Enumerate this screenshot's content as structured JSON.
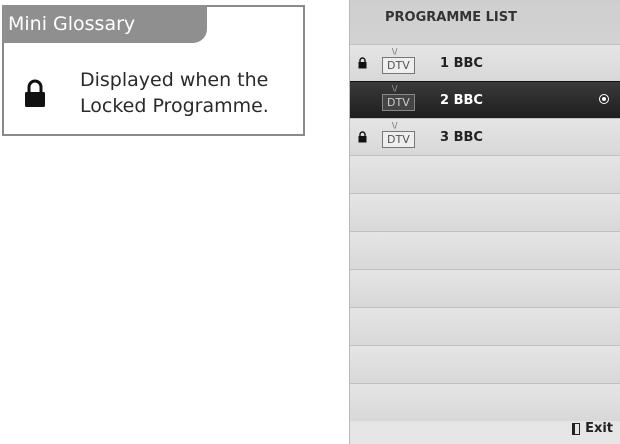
{
  "glossary": {
    "title": "Mini Glossary",
    "lock_icon": "lock-icon",
    "description_line1": "Displayed when the",
    "description_line2": "Locked Programme."
  },
  "programme_list": {
    "title": "PROGRAMME LIST",
    "items": [
      {
        "type": "DTV",
        "name": "1 BBC",
        "locked": true,
        "selected": false
      },
      {
        "type": "DTV",
        "name": "2 BBC",
        "locked": false,
        "selected": true
      },
      {
        "type": "DTV",
        "name": "3 BBC",
        "locked": true,
        "selected": false
      }
    ],
    "exit_label": "Exit",
    "exit_icon": "exit-icon"
  },
  "colors": {
    "selected_row": "#1e1e1e",
    "panel_bg": "#dcdcdc",
    "glossary_tab": "#8f8f8f"
  }
}
